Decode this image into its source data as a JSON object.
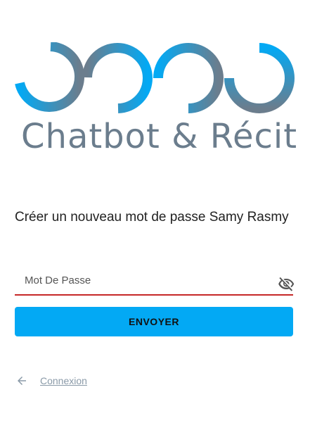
{
  "brand": {
    "name": "Chatbot & Récit",
    "logo_gradient_start": "#03a9f4",
    "logo_gradient_end": "#6b7d8d"
  },
  "form": {
    "title": "Créer un nouveau mot de passe Samy Rasmy",
    "password_placeholder": "Mot De Passe",
    "password_value": "",
    "submit_label": "ENVOYER",
    "error_color": "#c62828",
    "accent_color": "#03a9f4"
  },
  "footer": {
    "back_icon": "arrow-left-icon",
    "back_link_label": "Connexion"
  }
}
